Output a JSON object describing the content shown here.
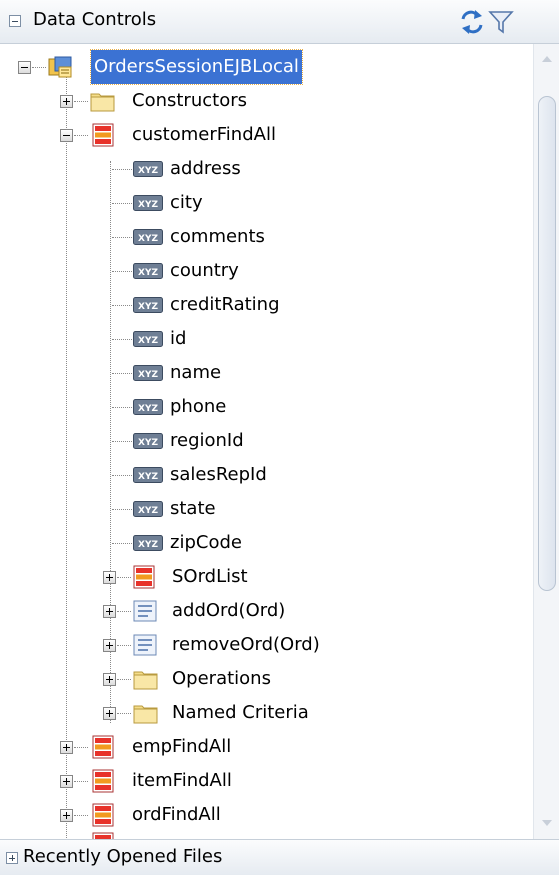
{
  "panel": {
    "title": "Data Controls",
    "refresh_icon": "refresh-icon",
    "filter_icon": "filter-icon"
  },
  "footer": {
    "title": "Recently Opened Files"
  },
  "tree": {
    "root": {
      "label": "OrdersSessionEJBLocal",
      "icon": "data-control-bean-icon",
      "expanded": true,
      "selected": true
    },
    "constructors": {
      "label": "Constructors",
      "icon": "folder-icon",
      "expanded": false
    },
    "customerFindAll": {
      "label": "customerFindAll",
      "icon": "collection-icon",
      "expanded": true
    },
    "attributes": [
      {
        "label": "address",
        "icon": "attribute-icon"
      },
      {
        "label": "city",
        "icon": "attribute-icon"
      },
      {
        "label": "comments",
        "icon": "attribute-icon"
      },
      {
        "label": "country",
        "icon": "attribute-icon"
      },
      {
        "label": "creditRating",
        "icon": "attribute-icon"
      },
      {
        "label": "id",
        "icon": "attribute-icon"
      },
      {
        "label": "name",
        "icon": "attribute-icon"
      },
      {
        "label": "phone",
        "icon": "attribute-icon"
      },
      {
        "label": "regionId",
        "icon": "attribute-icon"
      },
      {
        "label": "salesRepId",
        "icon": "attribute-icon"
      },
      {
        "label": "state",
        "icon": "attribute-icon"
      },
      {
        "label": "zipCode",
        "icon": "attribute-icon"
      }
    ],
    "children": [
      {
        "label": "SOrdList",
        "icon": "collection-icon"
      },
      {
        "label": "addOrd(Ord)",
        "icon": "method-icon"
      },
      {
        "label": "removeOrd(Ord)",
        "icon": "method-icon"
      },
      {
        "label": "Operations",
        "icon": "folder-icon"
      },
      {
        "label": "Named Criteria",
        "icon": "folder-icon"
      }
    ],
    "top_level": [
      {
        "label": "empFindAll",
        "icon": "collection-icon"
      },
      {
        "label": "itemFindAll",
        "icon": "collection-icon"
      },
      {
        "label": "ordFindAll",
        "icon": "collection-icon"
      }
    ]
  }
}
